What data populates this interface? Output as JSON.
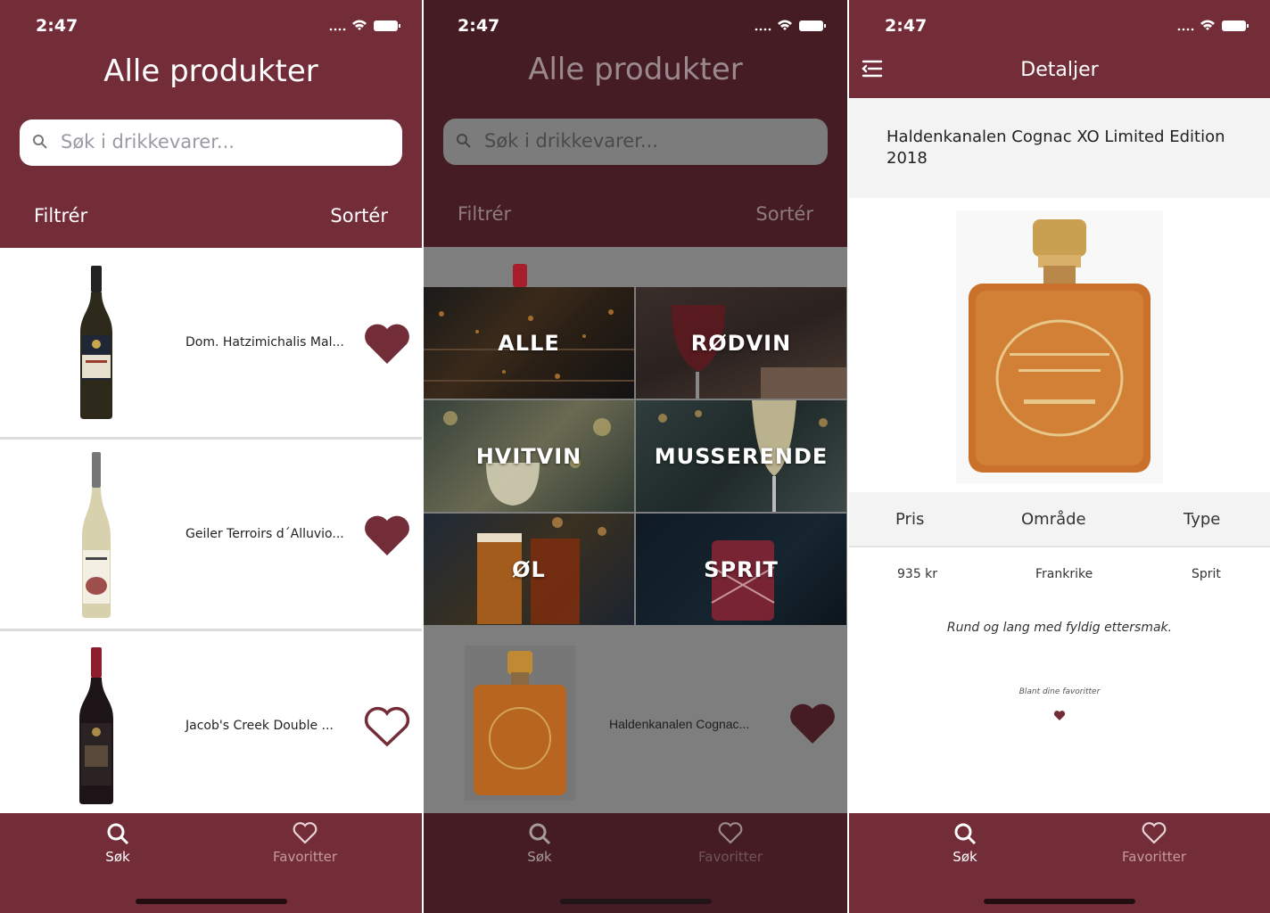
{
  "status": {
    "time": "2:47"
  },
  "screen1": {
    "title": "Alle produkter",
    "search_placeholder": "Søk i drikkevarer...",
    "filter_label": "Filtrér",
    "sort_label": "Sortér",
    "products": [
      {
        "name": "Dom. Hatzimichalis Mal...",
        "favorite": true
      },
      {
        "name": "Geiler Terroirs d´Alluvio...",
        "favorite": true
      },
      {
        "name": "Jacob's Creek Double ...",
        "favorite": false
      }
    ]
  },
  "screen2": {
    "title": "Alle produkter",
    "search_placeholder": "Søk i drikkevarer...",
    "filter_label": "Filtrér",
    "sort_label": "Sortér",
    "categories": [
      "ALLE",
      "RØDVIN",
      "HVITVIN",
      "MUSSERENDE",
      "ØL",
      "SPRIT"
    ],
    "product": {
      "name": "Haldenkanalen Cognac...",
      "favorite": true
    }
  },
  "screen3": {
    "title": "Detaljer",
    "product_name": "Haldenkanalen Cognac XO Limited Edition 2018",
    "columns": {
      "price": "Pris",
      "area": "Område",
      "type": "Type"
    },
    "values": {
      "price": "935 kr",
      "area": "Frankrike",
      "type": "Sprit"
    },
    "description": "Rund og lang med fyldig ettersmak.",
    "favorite_label": "Blant dine favoritter"
  },
  "tabs": {
    "search": "Søk",
    "favorites": "Favoritter"
  },
  "colors": {
    "brand": "#732d38",
    "brand_dark": "#461c24"
  }
}
